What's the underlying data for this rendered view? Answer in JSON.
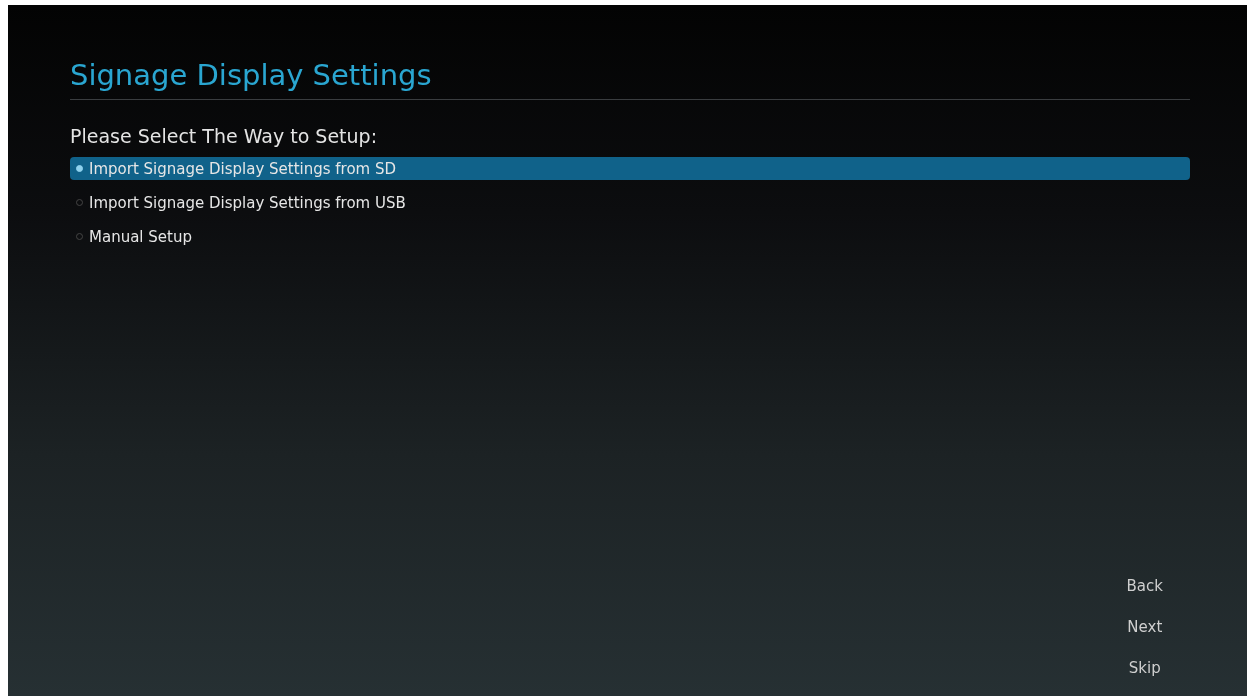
{
  "title": "Signage Display Settings",
  "prompt": "Please Select The Way to Setup:",
  "options": [
    {
      "label": "Import Signage Display Settings from SD",
      "selected": true
    },
    {
      "label": "Import Signage Display Settings from USB",
      "selected": false
    },
    {
      "label": "Manual Setup",
      "selected": false
    }
  ],
  "buttons": [
    "Back",
    "Next",
    "Skip"
  ]
}
